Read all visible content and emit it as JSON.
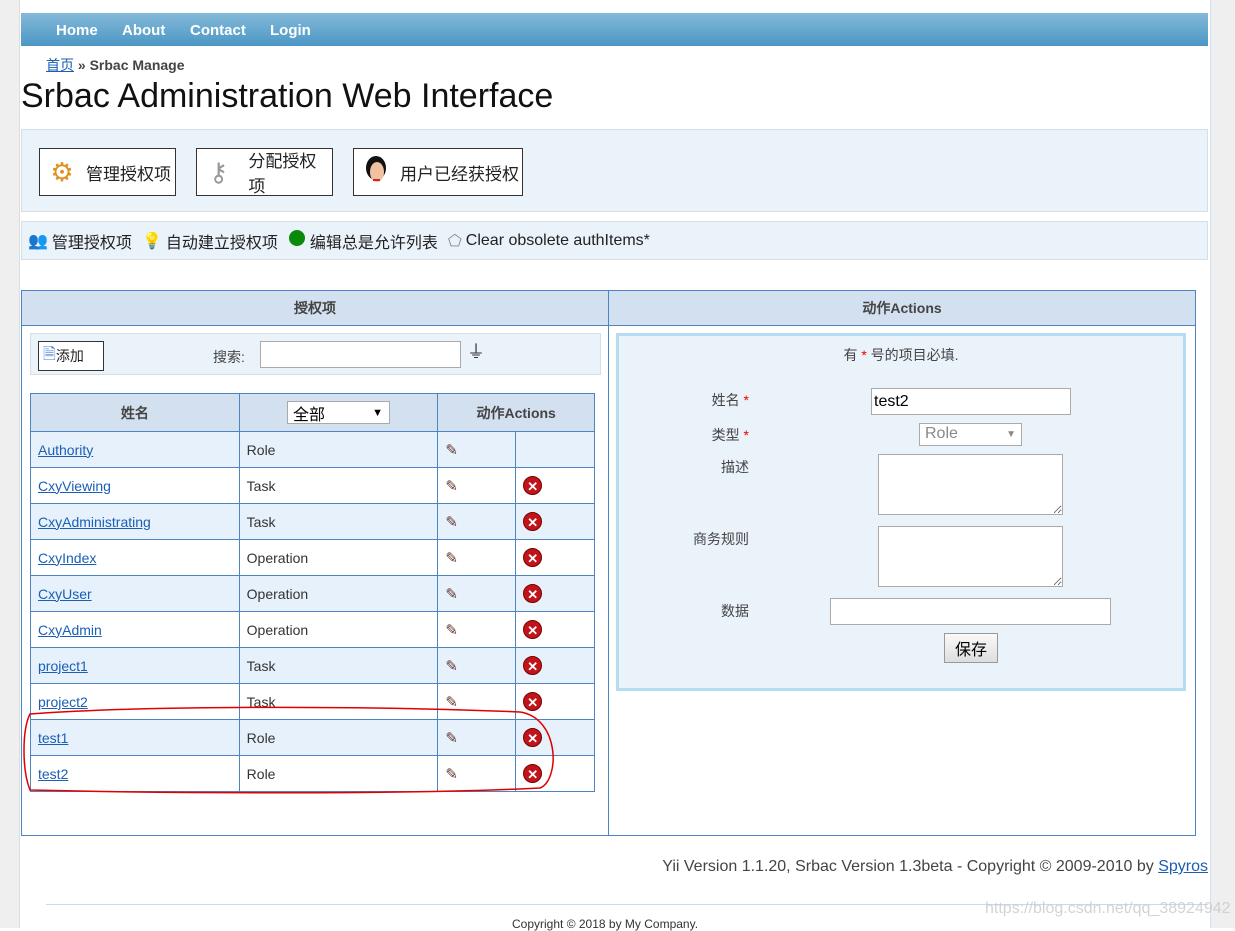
{
  "nav": {
    "items": [
      "Home",
      "About",
      "Contact",
      "Login"
    ]
  },
  "breadcrumb": {
    "home": "首页",
    "sep": "»",
    "current": "Srbac Manage"
  },
  "title": "Srbac Administration Web Interface",
  "main_buttons": [
    {
      "label": "管理授权项",
      "icon": "gear-icon"
    },
    {
      "label": "分配授权项",
      "icon": "key-icon"
    },
    {
      "label": "用户已经获授权",
      "icon": "user-avatar-icon"
    }
  ],
  "sub_menu": [
    {
      "label": "管理授权项",
      "icon": "users-icon"
    },
    {
      "label": "自动建立授权项",
      "icon": "lightbulb-icon"
    },
    {
      "label": "编辑总是允许列表",
      "icon": "green-dot-icon"
    },
    {
      "label": "Clear obsolete authItems*",
      "icon": "eraser-icon"
    }
  ],
  "left_panel": {
    "title": "授权项",
    "add_label": "添加",
    "search_label": "搜索:",
    "search_value": "",
    "table": {
      "col_name": "姓名",
      "filter_value": "全部",
      "col_actions": "动作Actions",
      "rows": [
        {
          "name": "Authority",
          "type": "Role",
          "deletable": false
        },
        {
          "name": "CxyViewing",
          "type": "Task",
          "deletable": true
        },
        {
          "name": "CxyAdministrating",
          "type": "Task",
          "deletable": true
        },
        {
          "name": "CxyIndex",
          "type": "Operation",
          "deletable": true
        },
        {
          "name": "CxyUser",
          "type": "Operation",
          "deletable": true
        },
        {
          "name": "CxyAdmin",
          "type": "Operation",
          "deletable": true
        },
        {
          "name": "project1",
          "type": "Task",
          "deletable": true
        },
        {
          "name": "project2",
          "type": "Task",
          "deletable": true
        },
        {
          "name": "test1",
          "type": "Role",
          "deletable": true
        },
        {
          "name": "test2",
          "type": "Role",
          "deletable": true
        }
      ]
    }
  },
  "right_panel": {
    "title": "动作Actions",
    "note_pre": "有",
    "note_star": "*",
    "note_post": "号的项目必填.",
    "form": {
      "name_label": "姓名",
      "name_value": "test2",
      "type_label": "类型",
      "type_value": "Role",
      "desc_label": "描述",
      "desc_value": "",
      "rule_label": "商务规则",
      "rule_value": "",
      "data_label": "数据",
      "data_value": "",
      "save_label": "保存"
    }
  },
  "footer": {
    "version_text": "Yii Version 1.1.20,  Srbac Version 1.3beta - Copyright © 2009-2010 by",
    "author_link": "Spyros",
    "copyright": "Copyright © 2018 by My Company.",
    "watermark": "https://blog.csdn.net/qq_38924942"
  },
  "colors": {
    "nav": "#4b97c4",
    "panel_header": "#d3e0ef",
    "border": "#4d84c2",
    "annotation": "#e00000"
  }
}
